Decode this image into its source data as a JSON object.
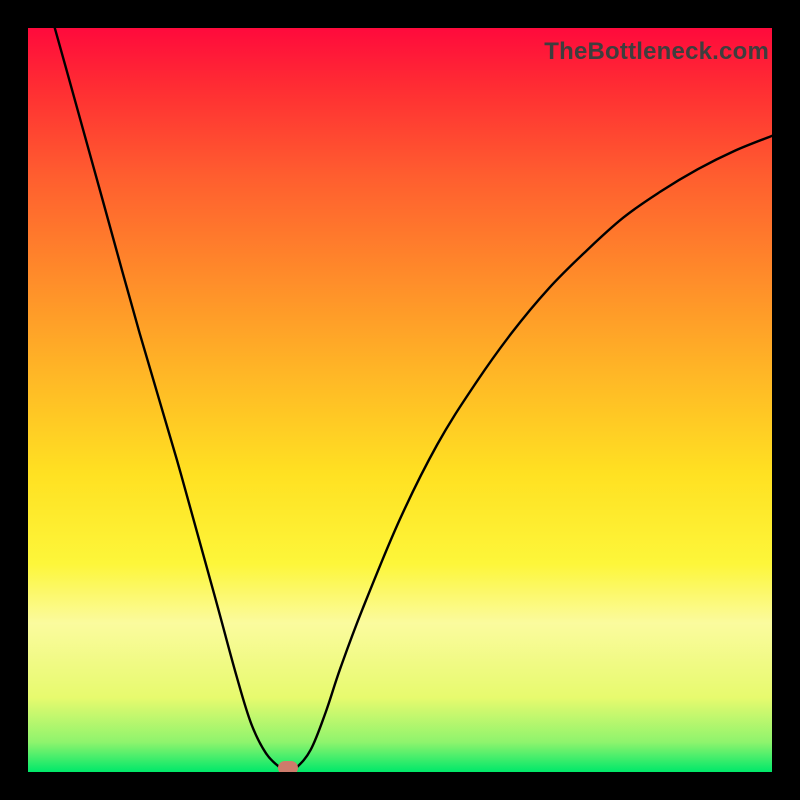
{
  "watermark": "TheBottleneck.com",
  "chart_data": {
    "type": "line",
    "title": "",
    "xlabel": "",
    "ylabel": "",
    "xlim": [
      0,
      100
    ],
    "ylim": [
      0,
      100
    ],
    "grid": false,
    "series": [
      {
        "name": "bottleneck-curve",
        "x": [
          3.6,
          5,
          10,
          15,
          20,
          25,
          28,
          30,
          32,
          34,
          35,
          36,
          38,
          40,
          42,
          45,
          50,
          55,
          60,
          65,
          70,
          75,
          80,
          85,
          90,
          95,
          100
        ],
        "y": [
          100,
          95,
          77,
          59,
          42,
          24,
          13,
          6.5,
          2.5,
          0.5,
          0,
          0.5,
          3,
          8,
          14,
          22,
          34,
          44,
          52,
          59,
          65,
          70,
          74.5,
          78,
          81,
          83.5,
          85.5
        ]
      }
    ],
    "annotations": [
      {
        "name": "min-marker",
        "x": 35,
        "y": 0.5,
        "color": "#cd7b6b"
      }
    ],
    "background": {
      "type": "vertical-gradient",
      "stops": [
        {
          "pos": 0,
          "color": "#ff0a3c"
        },
        {
          "pos": 0.5,
          "color": "#ffc825"
        },
        {
          "pos": 0.8,
          "color": "#fdfb80"
        },
        {
          "pos": 1.0,
          "color": "#00e86a"
        }
      ]
    }
  }
}
